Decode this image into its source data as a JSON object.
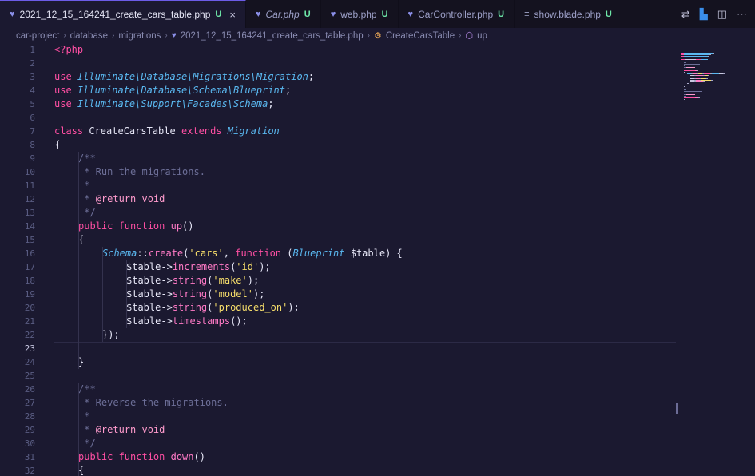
{
  "tabs": [
    {
      "name": "2021_12_15_164241_create_cars_table.php",
      "status": "U",
      "icon": "php-icon",
      "active": true,
      "italic": false,
      "close": "×"
    },
    {
      "name": "Car.php",
      "status": "U",
      "icon": "php-icon",
      "active": false,
      "italic": true
    },
    {
      "name": "web.php",
      "status": "U",
      "icon": "php-icon",
      "active": false,
      "italic": false
    },
    {
      "name": "CarController.php",
      "status": "U",
      "icon": "php-icon",
      "active": false,
      "italic": false
    },
    {
      "name": "show.blade.php",
      "status": "U",
      "icon": "file-lines-icon",
      "active": false,
      "italic": false
    }
  ],
  "breadcrumb": [
    "car-project",
    "database",
    "migrations",
    "2021_12_15_164241_create_cars_table.php",
    "CreateCarsTable",
    "up"
  ],
  "editor": {
    "current_line": 23,
    "lines": [
      {
        "n": "1",
        "indent": 0,
        "tokens": [
          [
            "tag",
            "<?php"
          ]
        ]
      },
      {
        "n": "2",
        "indent": 0,
        "tokens": []
      },
      {
        "n": "3",
        "indent": 0,
        "tokens": [
          [
            "kw",
            "use "
          ],
          [
            "ns",
            "Illuminate\\Database\\Migrations\\Migration"
          ],
          [
            "op",
            ";"
          ]
        ]
      },
      {
        "n": "4",
        "indent": 0,
        "tokens": [
          [
            "kw",
            "use "
          ],
          [
            "ns",
            "Illuminate\\Database\\Schema\\Blueprint"
          ],
          [
            "op",
            ";"
          ]
        ]
      },
      {
        "n": "5",
        "indent": 0,
        "tokens": [
          [
            "kw",
            "use "
          ],
          [
            "ns",
            "Illuminate\\Support\\Facades\\Schema"
          ],
          [
            "op",
            ";"
          ]
        ]
      },
      {
        "n": "6",
        "indent": 0,
        "tokens": []
      },
      {
        "n": "7",
        "indent": 0,
        "tokens": [
          [
            "kw",
            "class "
          ],
          [
            "cls",
            "CreateCarsTable "
          ],
          [
            "kw",
            "extends "
          ],
          [
            "it",
            "Migration"
          ]
        ]
      },
      {
        "n": "8",
        "indent": 0,
        "tokens": [
          [
            "op",
            "{"
          ]
        ]
      },
      {
        "n": "9",
        "indent": 1,
        "tokens": [
          [
            "cm",
            "/**"
          ]
        ]
      },
      {
        "n": "10",
        "indent": 1,
        "tokens": [
          [
            "cm",
            " * Run the migrations."
          ]
        ]
      },
      {
        "n": "11",
        "indent": 1,
        "tokens": [
          [
            "cm",
            " *"
          ]
        ]
      },
      {
        "n": "12",
        "indent": 1,
        "tokens": [
          [
            "cm",
            " * "
          ],
          [
            "ret",
            "@return void"
          ]
        ]
      },
      {
        "n": "13",
        "indent": 1,
        "tokens": [
          [
            "cm",
            " */"
          ]
        ]
      },
      {
        "n": "14",
        "indent": 1,
        "tokens": [
          [
            "kw",
            "public function "
          ],
          [
            "fn",
            "up"
          ],
          [
            "op",
            "()"
          ]
        ]
      },
      {
        "n": "15",
        "indent": 1,
        "tokens": [
          [
            "op",
            "{"
          ]
        ]
      },
      {
        "n": "16",
        "indent": 2,
        "tokens": [
          [
            "it",
            "Schema"
          ],
          [
            "op",
            "::"
          ],
          [
            "fn",
            "create"
          ],
          [
            "op",
            "("
          ],
          [
            "str",
            "'cars'"
          ],
          [
            "op",
            ", "
          ],
          [
            "kw",
            "function "
          ],
          [
            "op",
            "("
          ],
          [
            "it",
            "Blueprint "
          ],
          [
            "var",
            "$table"
          ],
          [
            "op",
            ") {"
          ]
        ]
      },
      {
        "n": "17",
        "indent": 3,
        "tokens": [
          [
            "var",
            "$table"
          ],
          [
            "op",
            "->"
          ],
          [
            "fn",
            "increments"
          ],
          [
            "op",
            "("
          ],
          [
            "str",
            "'id'"
          ],
          [
            "op",
            ");"
          ]
        ]
      },
      {
        "n": "18",
        "indent": 3,
        "tokens": [
          [
            "var",
            "$table"
          ],
          [
            "op",
            "->"
          ],
          [
            "fn",
            "string"
          ],
          [
            "op",
            "("
          ],
          [
            "str",
            "'make'"
          ],
          [
            "op",
            ");"
          ]
        ]
      },
      {
        "n": "19",
        "indent": 3,
        "tokens": [
          [
            "var",
            "$table"
          ],
          [
            "op",
            "->"
          ],
          [
            "fn",
            "string"
          ],
          [
            "op",
            "("
          ],
          [
            "str",
            "'model'"
          ],
          [
            "op",
            ");"
          ]
        ]
      },
      {
        "n": "20",
        "indent": 3,
        "tokens": [
          [
            "var",
            "$table"
          ],
          [
            "op",
            "->"
          ],
          [
            "fn",
            "string"
          ],
          [
            "op",
            "("
          ],
          [
            "str",
            "'produced_on'"
          ],
          [
            "op",
            ");"
          ]
        ]
      },
      {
        "n": "21",
        "indent": 3,
        "tokens": [
          [
            "var",
            "$table"
          ],
          [
            "op",
            "->"
          ],
          [
            "fn",
            "timestamps"
          ],
          [
            "op",
            "();"
          ]
        ]
      },
      {
        "n": "22",
        "indent": 2,
        "tokens": [
          [
            "op",
            "});"
          ]
        ]
      },
      {
        "n": "23",
        "indent": 0,
        "tokens": []
      },
      {
        "n": "24",
        "indent": 1,
        "tokens": [
          [
            "op",
            "}"
          ]
        ]
      },
      {
        "n": "25",
        "indent": 0,
        "tokens": []
      },
      {
        "n": "26",
        "indent": 1,
        "tokens": [
          [
            "cm",
            "/**"
          ]
        ]
      },
      {
        "n": "27",
        "indent": 1,
        "tokens": [
          [
            "cm",
            " * Reverse the migrations."
          ]
        ]
      },
      {
        "n": "28",
        "indent": 1,
        "tokens": [
          [
            "cm",
            " *"
          ]
        ]
      },
      {
        "n": "29",
        "indent": 1,
        "tokens": [
          [
            "cm",
            " * "
          ],
          [
            "ret",
            "@return void"
          ]
        ]
      },
      {
        "n": "30",
        "indent": 1,
        "tokens": [
          [
            "cm",
            " */"
          ]
        ]
      },
      {
        "n": "31",
        "indent": 1,
        "tokens": [
          [
            "kw",
            "public function "
          ],
          [
            "fn",
            "down"
          ],
          [
            "op",
            "()"
          ]
        ]
      },
      {
        "n": "32",
        "indent": 1,
        "tokens": [
          [
            "op",
            "{"
          ]
        ]
      }
    ]
  },
  "toolbar_icons": [
    "compare-changes-icon",
    "source-control-icon",
    "split-editor-icon",
    "more-actions-icon"
  ],
  "colors": {
    "background": "#1b1930",
    "keyword": "#ff4fa3",
    "string": "#f5dc6a",
    "type": "#5ab8f0",
    "comment": "#6d6f98",
    "modified": "#6ee7a8"
  }
}
